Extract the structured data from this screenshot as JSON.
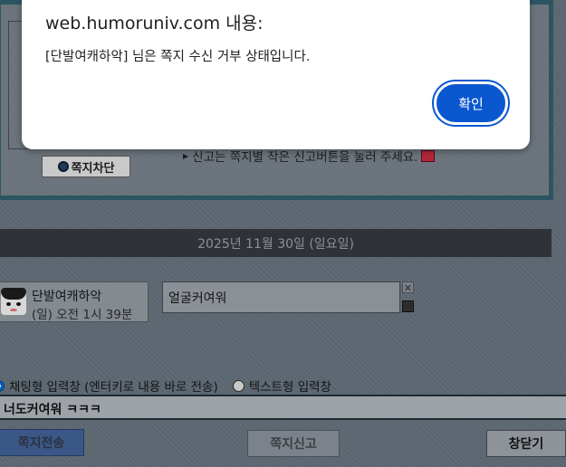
{
  "background": {
    "block_button_label": "쪽지차단",
    "report_note": "신고는 쪽지별 작은 신고버튼을 눌러 주세요.",
    "date_header": "2025년 11월 30일 (일요일)",
    "message": {
      "sender": "단발여캐하악",
      "time": "(일) 오전 1시 39분",
      "text": "얼굴커여워"
    },
    "input_modes": {
      "chat_label": "채팅형 입력창 (엔터키로 내용 바로 전송)",
      "text_label": "텍스트형 입력창",
      "selected": "chat"
    },
    "input_value": "너도커여워 ㅋㅋㅋ",
    "buttons": {
      "send": "쪽지전송",
      "report": "쪽지신고",
      "close": "창닫기"
    }
  },
  "dialog": {
    "title": "web.humoruniv.com 내용:",
    "message": "[단발여캐하악] 님은 쪽지 수신 거부 상태입니다.",
    "ok_label": "확인"
  },
  "colors": {
    "dialog_button": "#0b57d0",
    "panel_border": "#2c5562",
    "date_bar": "#2f3337"
  }
}
